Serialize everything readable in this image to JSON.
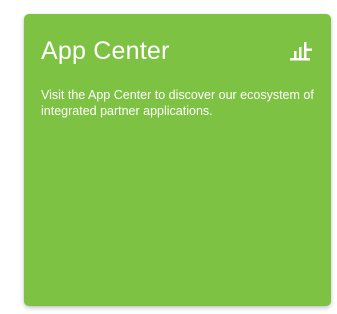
{
  "card": {
    "title": "App Center",
    "description": "Visit the App Center to discover our ecosystem of integrated partner applications.",
    "icon": "app-center-blocks-icon",
    "background_color": "#7dc242",
    "text_color": "#ffffff"
  }
}
